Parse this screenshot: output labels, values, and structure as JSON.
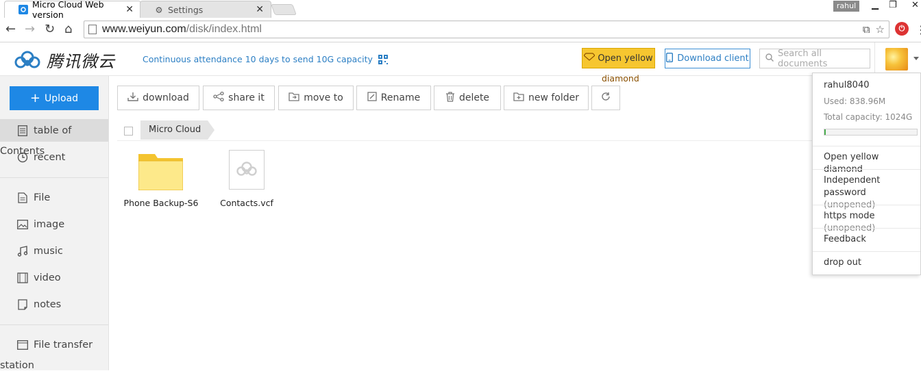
{
  "browser": {
    "tabs": [
      {
        "title": "Micro Cloud Web version",
        "active": true
      },
      {
        "title": "Settings",
        "active": false
      }
    ],
    "profile_name": "rahul",
    "url_host": "www.weiyun.com",
    "url_path": "/disk/index.html"
  },
  "header": {
    "brand": "腾讯微云",
    "promo_text": "Continuous attendance 10 days to send 10G capacity",
    "yellow_button": "Open yellow",
    "yellow_button_wrap": "diamond",
    "download_client": "Download client",
    "search_placeholder": "Search all documents"
  },
  "sidebar": {
    "upload_label": "Upload",
    "items": [
      {
        "label": "table of",
        "icon": "list-icon"
      },
      {
        "label": "recent",
        "icon": "clock-icon"
      },
      {
        "label": "File",
        "icon": "file-icon"
      },
      {
        "label": "image",
        "icon": "image-icon"
      },
      {
        "label": "music",
        "icon": "music-icon"
      },
      {
        "label": "video",
        "icon": "video-icon"
      },
      {
        "label": "notes",
        "icon": "notes-icon"
      },
      {
        "label": "File transfer",
        "icon": "transfer-icon"
      }
    ],
    "overflow_contents": "Contents",
    "overflow_station": "station"
  },
  "toolbar": {
    "download": "download",
    "share": "share it",
    "move": "move to",
    "rename": "Rename",
    "delete": "delete",
    "new_folder": "new folder"
  },
  "breadcrumb": {
    "root": "Micro Cloud"
  },
  "files": [
    {
      "name": "Phone Backup-S6",
      "type": "folder"
    },
    {
      "name": "Contacts.vcf",
      "type": "file"
    }
  ],
  "account_menu": {
    "username": "rahul8040",
    "used": "Used: 838.96M",
    "total": "Total capacity: 1024G",
    "usage_fraction": 0.0008,
    "items": {
      "yellow_diamond": "Open yellow diamond",
      "independent_password": "Independent password",
      "independent_password_state": "(unopened)",
      "https_mode": "https mode",
      "https_mode_state": "(unopened)",
      "feedback": "Feedback",
      "drop_out": "drop out"
    }
  },
  "colors": {
    "accent": "#1e88e5",
    "yellow": "#f6c630",
    "link": "#2c7fc4"
  }
}
